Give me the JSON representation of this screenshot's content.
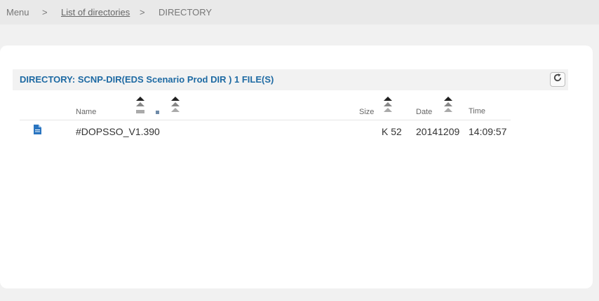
{
  "breadcrumb": {
    "menu": "Menu",
    "sep1": ">",
    "list_of_directories": "List of directories",
    "sep2": ">",
    "current": "DIRECTORY"
  },
  "directory": {
    "title": "DIRECTORY: SCNP-DIR(EDS Scenario Prod DIR ) 1 FILE(S)"
  },
  "columns": {
    "name": "Name",
    "size": "Size",
    "date": "Date",
    "time": "Time"
  },
  "files": [
    {
      "name": "#DOPSSO_V1.390",
      "size": "K 52",
      "date": "20141209",
      "time": "14:09:57",
      "icon": "file-icon"
    }
  ],
  "colors": {
    "accent": "#1e6aa3",
    "file_icon": "#2a75c0",
    "background": "#f1f1f1"
  }
}
